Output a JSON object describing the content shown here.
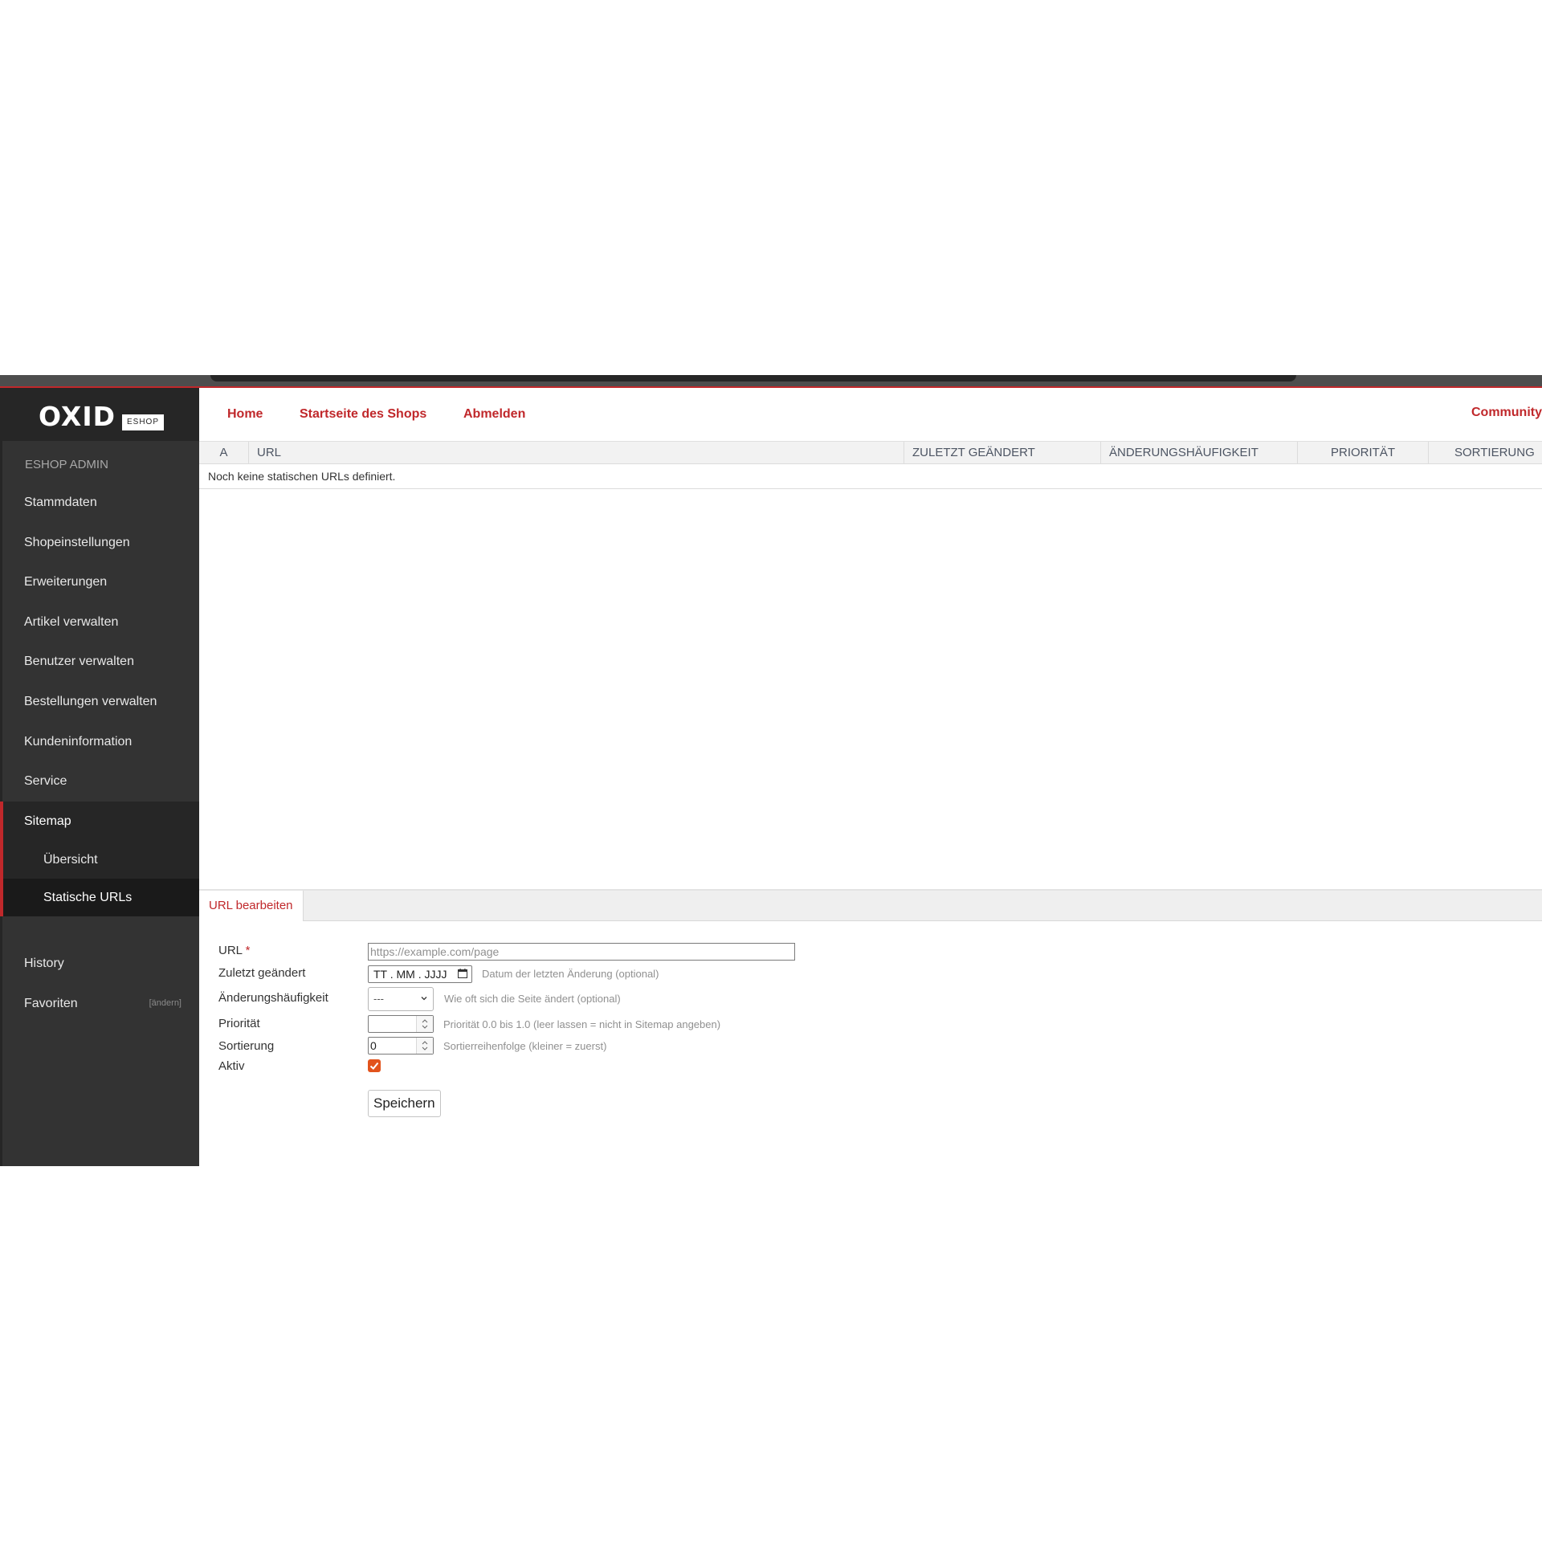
{
  "sidebar": {
    "logo": {
      "text": "OXID",
      "badge": "ESHOP"
    },
    "admin_label": "ESHOP ADMIN",
    "items": [
      {
        "label": "Stammdaten"
      },
      {
        "label": "Shopeinstellungen"
      },
      {
        "label": "Erweiterungen"
      },
      {
        "label": "Artikel verwalten"
      },
      {
        "label": "Benutzer verwalten"
      },
      {
        "label": "Bestellungen verwalten"
      },
      {
        "label": "Kundeninformation"
      },
      {
        "label": "Service"
      },
      {
        "label": "Sitemap"
      }
    ],
    "subitems": [
      {
        "label": "Übersicht"
      },
      {
        "label": "Statische URLs"
      }
    ],
    "history_label": "History",
    "favorites_label": "Favoriten",
    "favorites_change": "[ändern]"
  },
  "header": {
    "links": [
      "Home",
      "Startseite des Shops",
      "Abmelden"
    ],
    "community": "Community"
  },
  "table": {
    "columns": [
      "A",
      "URL",
      "ZULETZT GEÄNDERT",
      "ÄNDERUNGSHÄUFIGKEIT",
      "PRIORITÄT",
      "SORTIERUNG"
    ],
    "empty_text": "Noch keine statischen URLs definiert."
  },
  "edit_panel": {
    "tab_label": "URL bearbeiten",
    "fields": {
      "url": {
        "label": "URL",
        "required_mark": "*",
        "placeholder": "https://example.com/page",
        "value": ""
      },
      "last_modified": {
        "label": "Zuletzt geändert",
        "value": "TT . MM . JJJJ",
        "hint": "Datum der letzten Änderung (optional)"
      },
      "change_frequency": {
        "label": "Änderungshäufigkeit",
        "value": "---",
        "hint": "Wie oft sich die Seite ändert (optional)"
      },
      "priority": {
        "label": "Priorität",
        "value": "",
        "hint": "Priorität 0.0 bis 1.0 (leer lassen = nicht in Sitemap angeben)"
      },
      "sort": {
        "label": "Sortierung",
        "value": "0",
        "hint": "Sortierreihenfolge (kleiner = zuerst)"
      },
      "active": {
        "label": "Aktiv",
        "checked": true
      }
    },
    "save_label": "Speichern"
  },
  "colors": {
    "accent": "#c0282b",
    "sidebar": "#333333",
    "checkbox": "#e2531c"
  }
}
